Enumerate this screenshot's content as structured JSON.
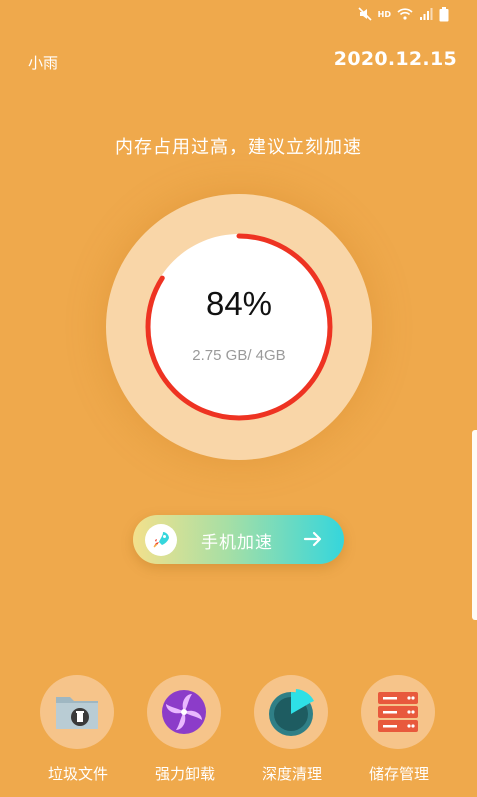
{
  "status_bar": {
    "network_type": "HD",
    "icons": [
      "mute-icon",
      "wifi-icon",
      "signal-icon",
      "battery-icon"
    ]
  },
  "header": {
    "user_name": "小雨",
    "date": "2020.12.15"
  },
  "headline": "内存占用过高，建议立刻加速",
  "memory": {
    "percent_label": "84%",
    "usage_label": "2.75 GB/ 4GB",
    "used_fraction": 0.84
  },
  "boost": {
    "label": "手机加速",
    "icon": "rocket-icon"
  },
  "tools": [
    {
      "label": "垃圾文件",
      "icon": "folder-trash-icon"
    },
    {
      "label": "强力卸载",
      "icon": "fan-icon"
    },
    {
      "label": "深度清理",
      "icon": "pie-clean-icon"
    },
    {
      "label": "储存管理",
      "icon": "storage-server-icon"
    }
  ],
  "colors": {
    "background": "#EFA94C",
    "gauge_ring": "#F9D6A8",
    "progress": "#EE3322",
    "accent_teal": "#35D6DC"
  }
}
